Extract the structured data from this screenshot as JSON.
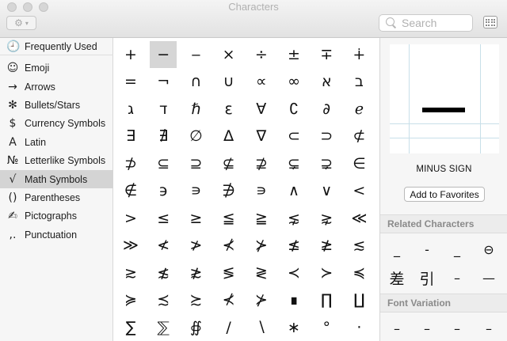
{
  "window": {
    "title": "Characters"
  },
  "toolbar": {
    "gear_icon": "gear-icon",
    "search_placeholder": "Search",
    "keyboard_icon": "keyboard-viewer-icon"
  },
  "sidebar": {
    "items": [
      {
        "icon": "🕘",
        "label": "Frequently Used"
      },
      {
        "icon": "☺",
        "label": "Emoji"
      },
      {
        "icon": "→",
        "label": "Arrows"
      },
      {
        "icon": "✻",
        "label": "Bullets/Stars"
      },
      {
        "icon": "$",
        "label": "Currency Symbols"
      },
      {
        "icon": "A",
        "label": "Latin"
      },
      {
        "icon": "№",
        "label": "Letterlike Symbols"
      },
      {
        "icon": "√",
        "label": "Math Symbols"
      },
      {
        "icon": "()",
        "label": "Parentheses"
      },
      {
        "icon": "✍",
        "label": "Pictographs"
      },
      {
        "icon": ",.",
        "label": "Punctuation"
      }
    ],
    "selected_index": 7
  },
  "grid": {
    "rows": [
      [
        "+",
        "−",
        "‒",
        "×",
        "÷",
        "±",
        "∓",
        "∔"
      ],
      [
        "=",
        "¬",
        "∩",
        "∪",
        "∝",
        "∞",
        "א",
        "ב"
      ],
      [
        "ג",
        "ד",
        "ℏ",
        "ε",
        "∀",
        "∁",
        "∂",
        "ℯ"
      ],
      [
        "∃",
        "∄",
        "∅",
        "∆",
        "∇",
        "⊂",
        "⊃",
        "⊄"
      ],
      [
        "⊅",
        "⊆",
        "⊇",
        "⊈",
        "⊉",
        "⊊",
        "⊋",
        "∈"
      ],
      [
        "∉",
        "϶",
        "∍",
        "∌",
        "∍",
        "∧",
        "∨",
        "<"
      ],
      [
        ">",
        "≤",
        "≥",
        "≦",
        "≧",
        "⋦",
        "⋧",
        "≪"
      ],
      [
        "≫",
        "≮",
        "≯",
        "⊀",
        "⊁",
        "≰",
        "≱",
        "≲"
      ],
      [
        "≳",
        "≴",
        "≵",
        "≶",
        "≷",
        "≺",
        "≻",
        "≼"
      ],
      [
        "≽",
        "≾",
        "≿",
        "⊀",
        "⊁",
        "∎",
        "∏",
        "∐"
      ],
      [
        "∑",
        "⅀",
        "∯",
        "/",
        "∖",
        "∗",
        "°",
        "·"
      ]
    ],
    "selected": "−"
  },
  "inspector": {
    "char_name": "MINUS SIGN",
    "favorites_label": "Add to Favorites",
    "related_heading": "Related Characters",
    "related": [
      "_",
      "‐",
      "_",
      "⊖",
      "差",
      "引",
      "–",
      "—"
    ],
    "font_variation_heading": "Font Variation",
    "font_variations": [
      "–",
      "–",
      "–",
      "–"
    ]
  }
}
